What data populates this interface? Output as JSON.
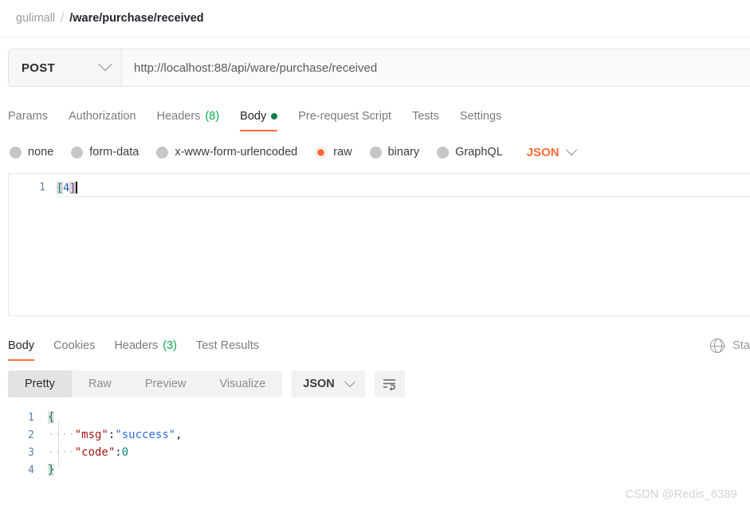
{
  "breadcrumb": {
    "collection": "gulimall",
    "separator": "/",
    "request_name": "/ware/purchase/received"
  },
  "request": {
    "method": "POST",
    "method_icon": "chevron-down-icon",
    "url": "http://localhost:88/api/ware/purchase/received",
    "tabs": [
      {
        "label": "Params",
        "active": false
      },
      {
        "label": "Authorization",
        "active": false
      },
      {
        "label": "Headers",
        "count": "(8)",
        "active": false
      },
      {
        "label": "Body",
        "active": true,
        "dot": true
      },
      {
        "label": "Pre-request Script",
        "active": false
      },
      {
        "label": "Tests",
        "active": false
      },
      {
        "label": "Settings",
        "active": false
      }
    ],
    "body_types": [
      {
        "label": "none",
        "checked": false
      },
      {
        "label": "form-data",
        "checked": false
      },
      {
        "label": "x-www-form-urlencoded",
        "checked": false
      },
      {
        "label": "raw",
        "checked": true
      },
      {
        "label": "binary",
        "checked": false
      },
      {
        "label": "GraphQL",
        "checked": false
      }
    ],
    "body_format": "JSON",
    "editor": {
      "line_number": "1",
      "bracket_open": "[",
      "value": "4",
      "bracket_close": "]"
    }
  },
  "response": {
    "tabs": [
      {
        "label": "Body",
        "active": true
      },
      {
        "label": "Cookies",
        "active": false
      },
      {
        "label": "Headers",
        "count": "(3)",
        "active": false
      },
      {
        "label": "Test Results",
        "active": false
      }
    ],
    "status_icon": "globe-icon",
    "status_text": "Sta",
    "view_modes": [
      {
        "label": "Pretty",
        "active": true
      },
      {
        "label": "Raw",
        "active": false
      },
      {
        "label": "Preview",
        "active": false
      },
      {
        "label": "Visualize",
        "active": false
      }
    ],
    "format": "JSON",
    "wrap_icon": "word-wrap-icon",
    "json": {
      "lines": [
        {
          "number": "1",
          "brace": "{"
        },
        {
          "number": "2",
          "indent": "····",
          "key": "\"msg\"",
          "colon": ": ",
          "value": "\"success\"",
          "trail": ","
        },
        {
          "number": "3",
          "indent": "····",
          "key": "\"code\"",
          "colon": ": ",
          "value": "0",
          "trail": ""
        },
        {
          "number": "4",
          "brace": "}"
        }
      ]
    }
  },
  "watermark": "CSDN @Redis_6389",
  "colors": {
    "accent": "#ff6c37",
    "green": "#0cab4a",
    "key": "#a31515",
    "string": "#2d6fd4",
    "number": "#0f8a7e"
  }
}
